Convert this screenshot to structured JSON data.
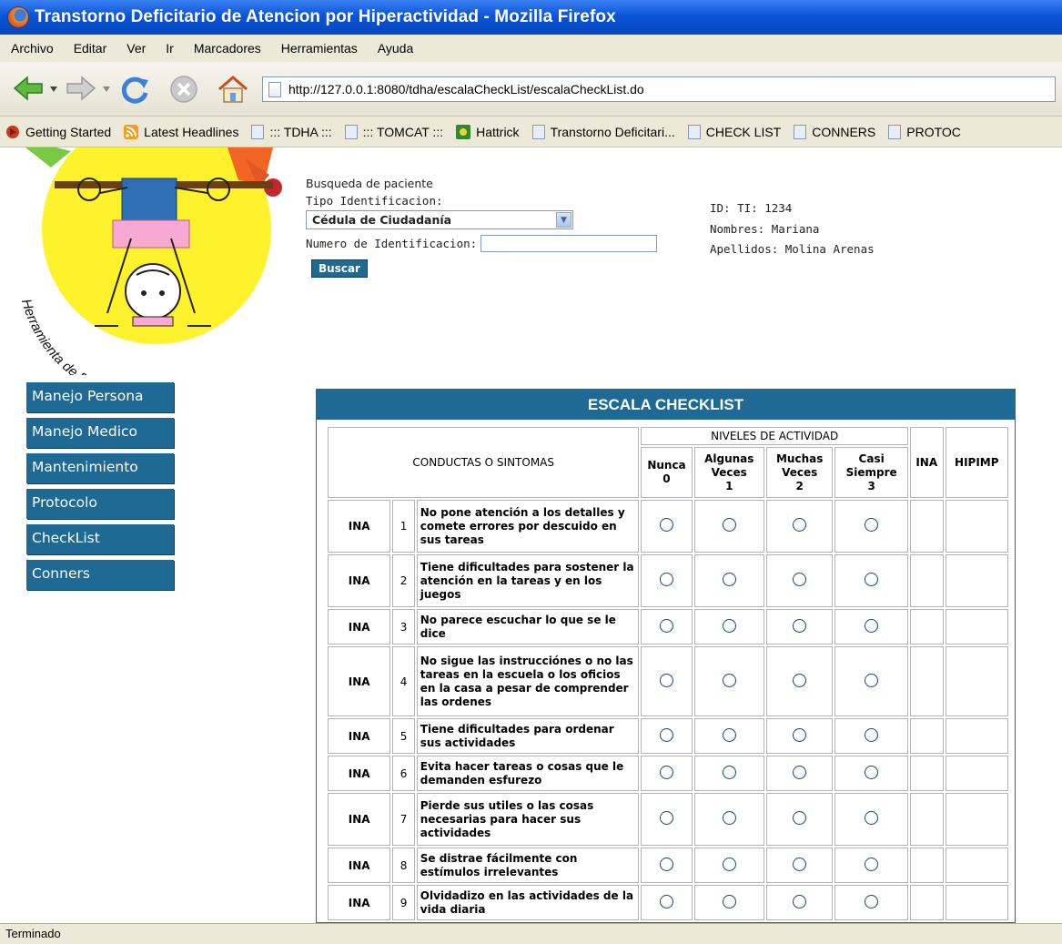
{
  "window": {
    "title": "Transtorno Deficitario de Atencion por Hiperactividad - Mozilla Firefox"
  },
  "menu": [
    "Archivo",
    "Editar",
    "Ver",
    "Ir",
    "Marcadores",
    "Herramientas",
    "Ayuda"
  ],
  "url": "http://127.0.0.1:8080/tdha/escalaCheckList/escalaCheckList.do",
  "bookmarks": [
    "Getting Started",
    "Latest Headlines",
    "::: TDHA :::",
    "::: TOMCAT :::",
    "Hattrick",
    "Transtorno Deficitari...",
    "CHECK LIST",
    "CONNERS",
    "PROTOC"
  ],
  "logo_text": "Herramienta de Pre-diagnostico de TDAH",
  "search": {
    "heading": "Busqueda de paciente",
    "tipo_label": "Tipo Identificacion:",
    "tipo_value": "Cédula de Ciudadanía",
    "numero_label": "Numero de Identificacion:",
    "numero_value": "",
    "buscar": "Buscar"
  },
  "patient": {
    "id": "ID: TI: 1234",
    "nombres": "Nombres: Mariana",
    "apellidos": "Apellidos: Molina Arenas"
  },
  "sidebar": [
    "Manejo Persona",
    "Manejo Medico",
    "Mantenimiento",
    "Protocolo",
    "CheckList",
    "Conners"
  ],
  "checklist": {
    "title": "ESCALA CHECKLIST",
    "col_conductas": "CONDUCTAS O SINTOMAS",
    "col_niveles": "NIVELES DE ACTIVIDAD",
    "levels": [
      {
        "label": "Nunca",
        "value": "0"
      },
      {
        "label": "Algunas Veces",
        "value": "1"
      },
      {
        "label": "Muchas Veces",
        "value": "2"
      },
      {
        "label": "Casi Siempre",
        "value": "3"
      }
    ],
    "col_ina": "INA",
    "col_hipimp": "HIPIMP",
    "rows": [
      {
        "type": "INA",
        "num": "1",
        "text": "No pone atención a los detalles y comete errores por descuido en sus tareas"
      },
      {
        "type": "INA",
        "num": "2",
        "text": "Tiene dificultades para sostener la atención en la tareas y en los juegos"
      },
      {
        "type": "INA",
        "num": "3",
        "text": "No parece escuchar lo que se le dice"
      },
      {
        "type": "INA",
        "num": "4",
        "text": "No sigue las instrucciónes o no las tareas en la escuela o los oficios en la casa a pesar de comprender las ordenes"
      },
      {
        "type": "INA",
        "num": "5",
        "text": "Tiene dificultades para ordenar sus actividades"
      },
      {
        "type": "INA",
        "num": "6",
        "text": "Evita hacer tareas o cosas que le demanden esfurezo"
      },
      {
        "type": "INA",
        "num": "7",
        "text": "Pierde sus utiles o las cosas necesarias para hacer sus actividades"
      },
      {
        "type": "INA",
        "num": "8",
        "text": "Se distrae fácilmente con estímulos irrelevantes"
      },
      {
        "type": "INA",
        "num": "9",
        "text": "Olvidadizo en las actividades de la vida diaria"
      }
    ]
  },
  "status": "Terminado",
  "colors": {
    "accent": "#1f6a95",
    "titlebar": "#0a55d9",
    "chrome": "#ece9d8"
  }
}
